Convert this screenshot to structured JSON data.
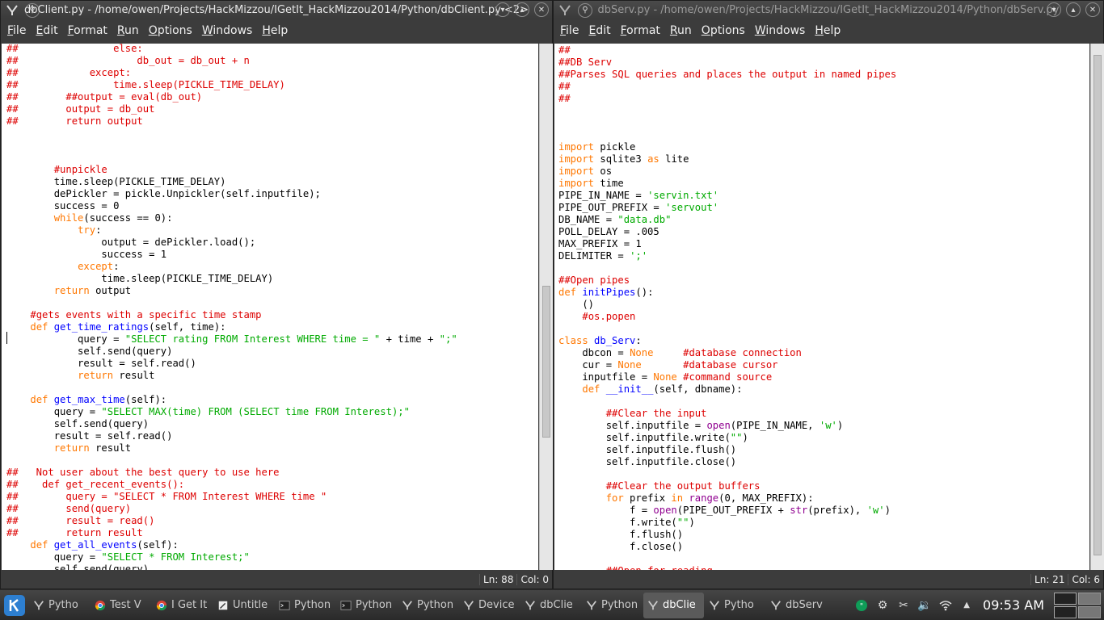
{
  "left_window": {
    "title": "dbClient.py - /home/owen/Projects/HackMizzou/IGetIt_HackMizzou2014/Python/dbClient.py <2>",
    "menu": [
      "File",
      "Edit",
      "Format",
      "Run",
      "Options",
      "Windows",
      "Help"
    ],
    "status_line": "Ln: 88",
    "status_col": "Col: 0"
  },
  "right_window": {
    "title": "dbServ.py - /home/owen/Projects/HackMizzou/IGetIt_HackMizzou2014/Python/dbServ.py",
    "menu": [
      "File",
      "Edit",
      "Format",
      "Run",
      "Options",
      "Windows",
      "Help"
    ],
    "status_line": "Ln: 21",
    "status_col": "Col: 6"
  },
  "taskbar": {
    "tasks": [
      {
        "label": "Pytho",
        "icon": "idle-icon",
        "active": false
      },
      {
        "label": "Test V",
        "icon": "chrome-icon",
        "active": false
      },
      {
        "label": "I Get It",
        "icon": "chrome-icon",
        "active": false
      },
      {
        "label": "Untitle",
        "icon": "text-editor-icon",
        "active": false
      },
      {
        "label": "Python",
        "icon": "terminal-icon",
        "active": false
      },
      {
        "label": "Python",
        "icon": "terminal-icon",
        "active": false
      },
      {
        "label": "Python",
        "icon": "idle-icon",
        "active": false
      },
      {
        "label": "Device",
        "icon": "idle-icon",
        "active": false
      },
      {
        "label": "dbClie",
        "icon": "idle-icon",
        "active": false
      },
      {
        "label": "Python",
        "icon": "idle-icon",
        "active": false
      },
      {
        "label": "dbClie",
        "icon": "idle-icon",
        "active": true
      },
      {
        "label": "Pytho",
        "icon": "idle-icon",
        "active": false
      },
      {
        "label": "dbServ",
        "icon": "idle-icon",
        "active": false
      }
    ],
    "clock": "09:53 AM"
  }
}
